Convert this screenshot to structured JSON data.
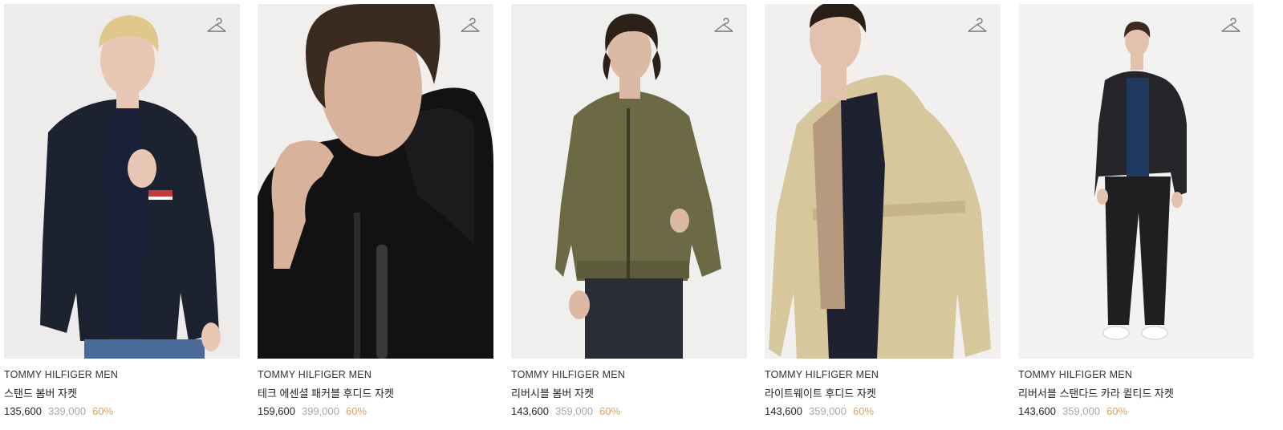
{
  "products": [
    {
      "brand": "TOMMY HILFIGER MEN",
      "name": "스탠드 봄버 자켓",
      "price": "135,600",
      "original_price": "339,000",
      "discount": "60%",
      "image": "model-in-black-stand-collar-bomber-jacket",
      "icon": "hanger-icon",
      "colors": {
        "bg": "#eeeceb",
        "garment": "#1c2230",
        "skin": "#e8c8b4",
        "hair": "#e0c78a",
        "pants": "#4a6a9a"
      }
    },
    {
      "brand": "TOMMY HILFIGER MEN",
      "name": "테크 에센셜 패커블 후디드 자켓",
      "price": "159,600",
      "original_price": "399,000",
      "discount": "60%",
      "image": "model-in-black-packable-hooded-jacket-closeup",
      "icon": "hanger-icon",
      "colors": {
        "bg": "#f0efed",
        "garment": "#121212",
        "skin": "#d9b29c",
        "hair": "#3a2a20",
        "pants": "#121212"
      }
    },
    {
      "brand": "TOMMY HILFIGER MEN",
      "name": "리버시블 봄버 자켓",
      "price": "143,600",
      "original_price": "359,000",
      "discount": "60%",
      "image": "model-in-olive-reversible-bomber-jacket",
      "icon": "hanger-icon",
      "colors": {
        "bg": "#efefed",
        "garment": "#6b6a44",
        "skin": "#dcb9a4",
        "hair": "#2c2018",
        "pants": "#2a2d33"
      }
    },
    {
      "brand": "TOMMY HILFIGER MEN",
      "name": "라이트웨이트 후디드 자켓",
      "price": "143,600",
      "original_price": "359,000",
      "discount": "60%",
      "image": "model-in-beige-lightweight-hooded-jacket",
      "icon": "hanger-icon",
      "colors": {
        "bg": "#f1f0ee",
        "garment": "#d6c79c",
        "skin": "#e3c2ad",
        "hair": "#2a1f18",
        "pants": "#1e2230"
      }
    },
    {
      "brand": "TOMMY HILFIGER MEN",
      "name": "리버서블 스탠다드 카라 퀼티드 자켓",
      "price": "143,600",
      "original_price": "359,000",
      "discount": "60%",
      "image": "full-length-model-in-black-quilted-jacket",
      "icon": "hanger-icon",
      "colors": {
        "bg": "#f2f2f1",
        "garment": "#26262a",
        "skin": "#e2c2ac",
        "hair": "#3a2a1f",
        "pants": "#1f1f22"
      }
    }
  ]
}
